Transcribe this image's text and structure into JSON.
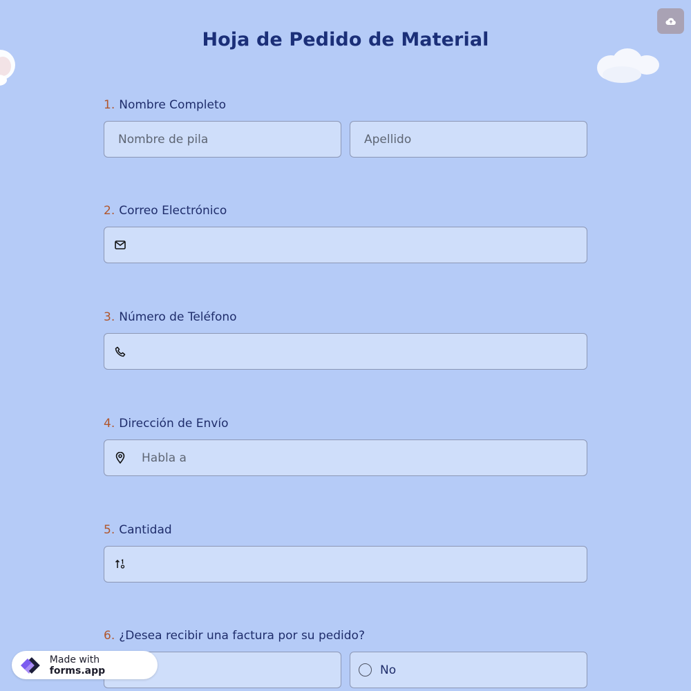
{
  "header": {
    "title": "Hoja de Pedido de Material"
  },
  "toolbar": {
    "save_icon": "cloud-upload-icon"
  },
  "questions": [
    {
      "number": "1.",
      "label": "Nombre Completo",
      "first_name_placeholder": "Nombre de pila",
      "last_name_placeholder": "Apellido"
    },
    {
      "number": "2.",
      "label": "Correo Electrónico",
      "icon": "envelope-icon",
      "placeholder": ""
    },
    {
      "number": "3.",
      "label": "Número de Teléfono",
      "icon": "phone-icon",
      "placeholder": ""
    },
    {
      "number": "4.",
      "label": "Dirección de Envío",
      "icon": "location-pin-icon",
      "placeholder": "Habla a"
    },
    {
      "number": "5.",
      "label": "Cantidad",
      "icon": "number-sort-icon",
      "placeholder": ""
    },
    {
      "number": "6.",
      "label": "¿Desea recibir una factura por su pedido?",
      "options": [
        "",
        "No"
      ]
    }
  ],
  "badge": {
    "prefix": "Made with",
    "brand": "forms.app"
  },
  "colors": {
    "background": "#b5cbf7",
    "field": "#cfdefa",
    "title": "#1b2f78",
    "number": "#b0562c"
  }
}
